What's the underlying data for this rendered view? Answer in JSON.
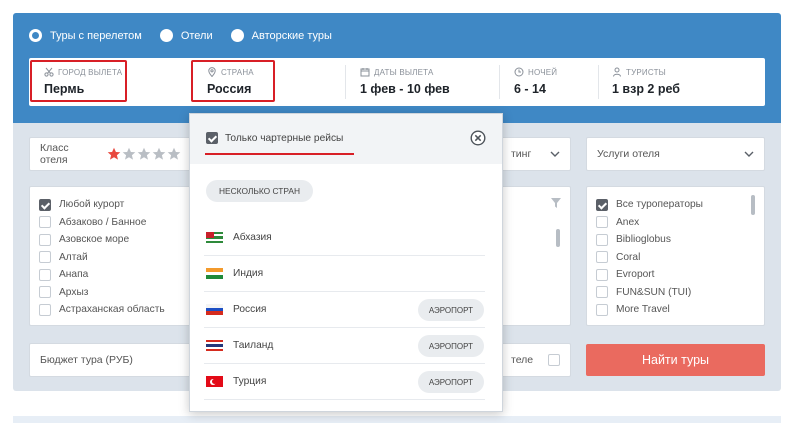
{
  "tour_types": [
    {
      "label": "Туры с перелетом",
      "selected": true
    },
    {
      "label": "Отели",
      "selected": false
    },
    {
      "label": "Авторские туры",
      "selected": false
    }
  ],
  "search": {
    "city": {
      "label": "ГОРОД ВЫЛЕТА",
      "value": "Пермь",
      "icon": "scissors-icon"
    },
    "country": {
      "label": "СТРАНА",
      "value": "Россия",
      "icon": "map-pin-icon"
    },
    "dates": {
      "label": "ДАТЫ ВЫЛЕТА",
      "value": "1 фев - 10 фев",
      "icon": "calendar-icon"
    },
    "nights": {
      "label": "НОЧЕЙ",
      "value": "6 - 14",
      "icon": "clock-icon"
    },
    "tourists": {
      "label": "ТУРИСТЫ",
      "value": "1 взр 2 реб",
      "icon": "person-icon"
    }
  },
  "filters": {
    "hotel_class": {
      "label": "Класс отеля",
      "stars_total": 5,
      "stars_selected": 1
    },
    "rating": {
      "label": "тинг"
    },
    "hotel_services": {
      "label": "Услуги отеля"
    },
    "budget": {
      "placeholder": "Бюджет тура (РУБ)"
    },
    "meal_partial": {
      "label": "теле"
    }
  },
  "resorts": [
    {
      "label": "Любой курорт",
      "checked": true
    },
    {
      "label": "Абзаково / Банное",
      "checked": false
    },
    {
      "label": "Азовское море",
      "checked": false
    },
    {
      "label": "Алтай",
      "checked": false
    },
    {
      "label": "Анапа",
      "checked": false
    },
    {
      "label": "Архыз",
      "checked": false
    },
    {
      "label": "Астраханская область",
      "checked": false
    }
  ],
  "operators": [
    {
      "label": "Все туроператоры",
      "checked": true
    },
    {
      "label": "Anex",
      "checked": false
    },
    {
      "label": "Biblioglobus",
      "checked": false
    },
    {
      "label": "Coral",
      "checked": false
    },
    {
      "label": "Evroport",
      "checked": false
    },
    {
      "label": "FUN&SUN (TUI)",
      "checked": false
    },
    {
      "label": "More Travel",
      "checked": false
    }
  ],
  "find_button": "Найти туры",
  "country_popup": {
    "charter_label": "Только чартерные рейсы",
    "charter_checked": true,
    "multi_country_button": "НЕСКОЛЬКО СТРАН",
    "airport_label": "АЭРОПОРТ",
    "countries": [
      {
        "name": "Абхазия",
        "flag": "abkhazia",
        "airport": false
      },
      {
        "name": "Индия",
        "flag": "india",
        "airport": false
      },
      {
        "name": "Россия",
        "flag": "russia",
        "airport": true
      },
      {
        "name": "Таиланд",
        "flag": "thailand",
        "airport": true
      },
      {
        "name": "Турция",
        "flag": "turkey",
        "airport": true
      }
    ]
  },
  "colors": {
    "header_blue": "#3f88c5",
    "filter_bg": "#dce3eb",
    "find_button": "#ea6a5f",
    "highlight_red": "#d81f26",
    "star_active": "#e8483e",
    "star_inactive": "#b9bec4"
  }
}
